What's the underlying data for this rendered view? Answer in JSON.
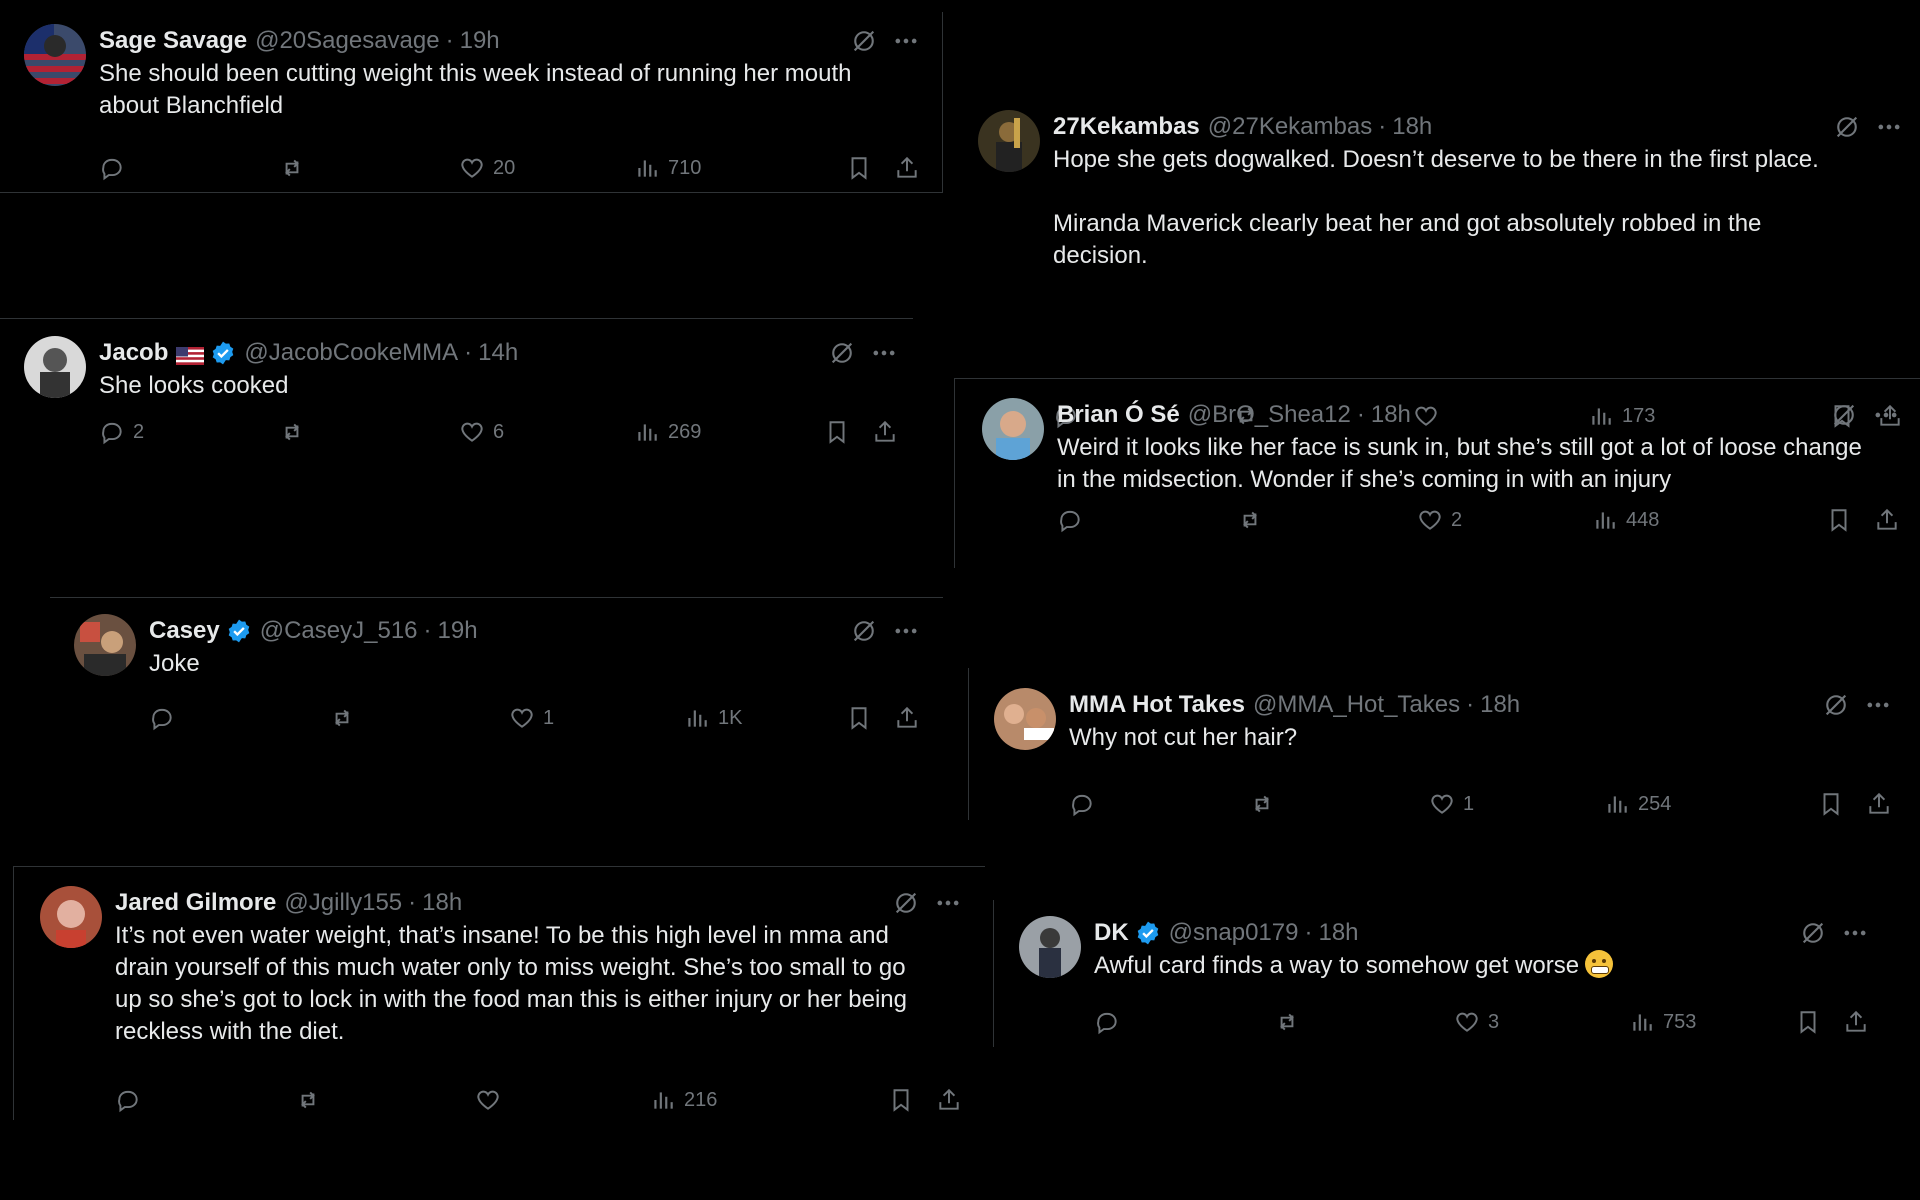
{
  "colors": {
    "background": "#000000",
    "text": "#e7e9ea",
    "muted": "#71767b",
    "verified": "#1d9bf0",
    "divider": "#2f3336"
  },
  "tweets": [
    {
      "name": "Sage Savage",
      "handle": "@20Sagesavage",
      "time": "19h",
      "text": "She should been cutting weight this week instead of running her mouth\nabout Blanchfield",
      "replies": "",
      "likes": "20",
      "views": "710"
    },
    {
      "name": "27Kekambas",
      "handle": "@27Kekambas",
      "time": "18h",
      "text": "Hope she gets dogwalked. Doesn’t deserve to be there in the first place.\n\nMiranda Maverick clearly beat her and got absolutely robbed in the\ndecision.",
      "replies": "",
      "likes": "",
      "views": "173"
    },
    {
      "name": "Jacob",
      "handle": "@JacobCookeMMA",
      "time": "14h",
      "text": "She looks cooked",
      "replies": "2",
      "likes": "6",
      "views": "269"
    },
    {
      "name": "Brian Ó Sé",
      "handle": "@BrO_Shea12",
      "time": "18h",
      "text": "Weird it looks like her face is sunk in, but she’s still got a lot of loose change\nin the midsection. Wonder if she’s coming in with an injury",
      "replies": "",
      "likes": "2",
      "views": "448"
    },
    {
      "name": "Casey",
      "handle": "@CaseyJ_516",
      "time": "19h",
      "text": "Joke",
      "replies": "",
      "likes": "1",
      "views": "1K"
    },
    {
      "name": "MMA Hot Takes",
      "handle": "@MMA_Hot_Takes",
      "time": "18h",
      "text": "Why not cut her hair?",
      "replies": "",
      "likes": "1",
      "views": "254"
    },
    {
      "name": "Jared Gilmore",
      "handle": "@Jgilly155",
      "time": "18h",
      "text": "It’s not even water weight, that’s insane! To be this high level in mma and\ndrain yourself of this much water only to miss weight. She’s too small to go\nup so she’s got to lock in with the food man this is either injury or her being\nreckless with the diet.",
      "replies": "",
      "likes": "",
      "views": "216"
    },
    {
      "name": "DK",
      "handle": "@snap0179",
      "time": "18h",
      "text": "Awful card finds a way to somehow get worse",
      "replies": "",
      "likes": "3",
      "views": "753"
    }
  ]
}
